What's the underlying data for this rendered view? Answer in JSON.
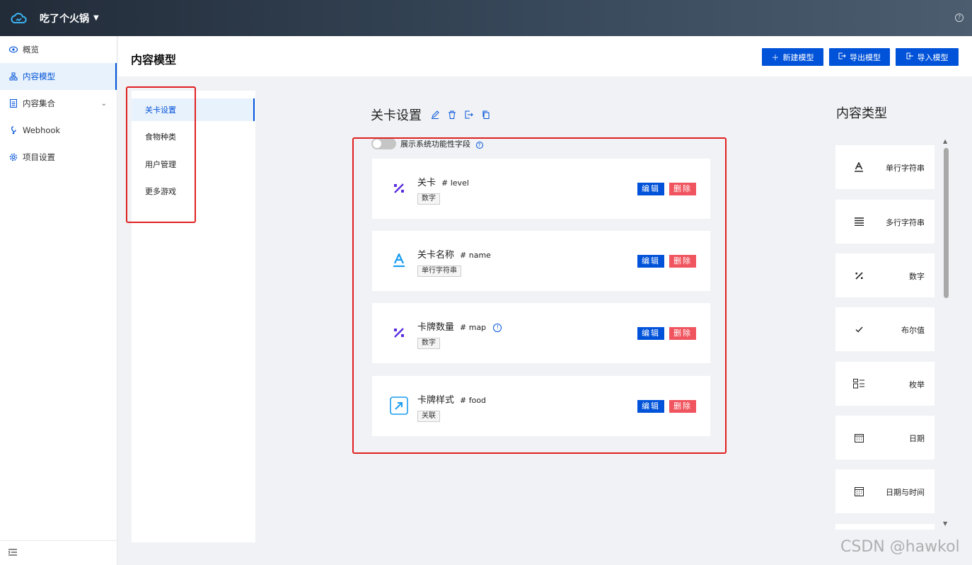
{
  "app": {
    "name": "吃了个火锅",
    "help": "?"
  },
  "sidebar": {
    "items": [
      {
        "label": "概览",
        "icon": "eye-icon"
      },
      {
        "label": "内容模型",
        "icon": "model-icon",
        "active": true
      },
      {
        "label": "内容集合",
        "icon": "collection-icon"
      },
      {
        "label": "Webhook",
        "icon": "webhook-icon"
      },
      {
        "label": "项目设置",
        "icon": "gear-icon"
      }
    ]
  },
  "header": {
    "title": "内容模型",
    "buttons": {
      "new": "新建模型",
      "export": "导出模型",
      "import": "导入模型"
    }
  },
  "models": {
    "items": [
      "关卡设置",
      "食物种类",
      "用户管理",
      "更多游戏"
    ],
    "active": "关卡设置"
  },
  "schema": {
    "title": "关卡设置",
    "toggle_label": "展示系统功能性字段",
    "fields": [
      {
        "name": "关卡",
        "key": "# level",
        "type": "数字",
        "icon": "number-icon"
      },
      {
        "name": "关卡名称",
        "key": "# name",
        "type": "单行字符串",
        "icon": "text-icon"
      },
      {
        "name": "卡牌数量",
        "key": "# map",
        "type": "数字",
        "icon": "number-icon",
        "info": true
      },
      {
        "name": "卡牌样式",
        "key": "# food",
        "type": "关联",
        "icon": "relation-icon"
      }
    ],
    "edit_label": "编辑",
    "delete_label": "删除"
  },
  "types": {
    "title": "内容类型",
    "items": [
      "单行字符串",
      "多行字符串",
      "数字",
      "布尔值",
      "枚举",
      "日期",
      "日期与时间"
    ]
  },
  "colors": {
    "primary": "#0052d9",
    "danger": "#f0545e",
    "annotation": "#e02020",
    "number_icon": "#5b2ee0",
    "text_icon": "#1a9cf0"
  },
  "watermark": "CSDN @hawkol"
}
